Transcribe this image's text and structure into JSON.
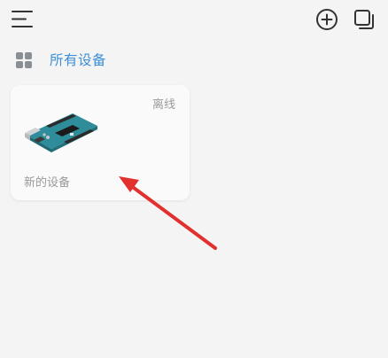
{
  "toolbar": {
    "menu_icon": "menu-icon",
    "add_icon": "add-circle-icon",
    "copy_icon": "copy-icon"
  },
  "group": {
    "icon": "grid-icon",
    "label": "所有设备"
  },
  "devices": [
    {
      "name": "新的设备",
      "status": "离线",
      "image": "arduino-board-image"
    }
  ],
  "colors": {
    "background": "#f4f4f4",
    "accent": "#3c8fd6",
    "card": "#fafafa",
    "muted_text": "#9a9a9a",
    "annotation_arrow": "#e2302f"
  }
}
